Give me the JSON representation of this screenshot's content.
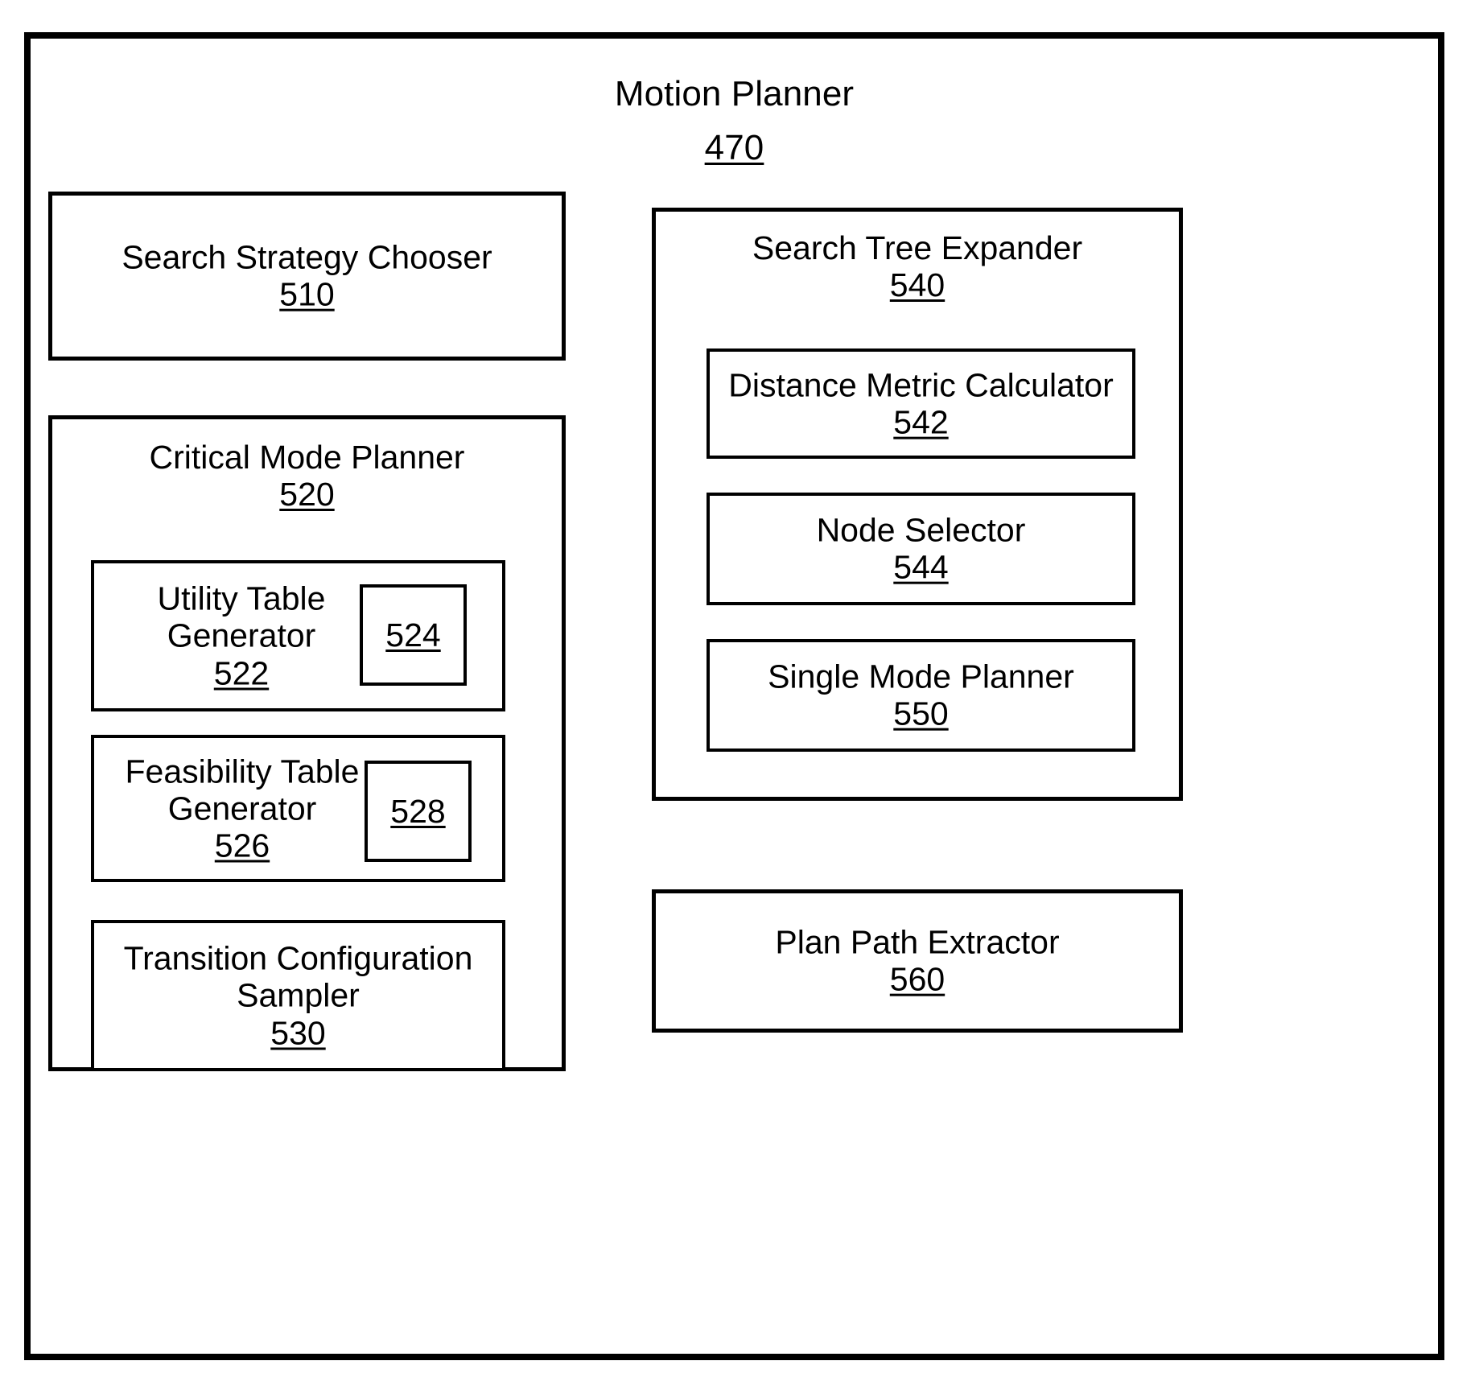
{
  "figure": {
    "root": {
      "title": "Motion Planner",
      "ref": "470"
    },
    "blocks": {
      "search_strategy_chooser": {
        "title": "Search Strategy Chooser",
        "ref": "510"
      },
      "critical_mode_planner": {
        "title": "Critical Mode Planner",
        "ref": "520"
      },
      "utility_table_generator": {
        "title": "Utility Table\nGenerator",
        "ref": "522",
        "sub_ref": "524"
      },
      "feasibility_table_generator": {
        "title": "Feasibility Table\nGenerator",
        "ref": "526",
        "sub_ref": "528"
      },
      "transition_configuration_sampler": {
        "title": "Transition Configuration\nSampler",
        "ref": "530"
      },
      "search_tree_expander": {
        "title": "Search Tree Expander",
        "ref": "540"
      },
      "distance_metric_calculator": {
        "title": "Distance Metric Calculator",
        "ref": "542"
      },
      "node_selector": {
        "title": "Node Selector",
        "ref": "544"
      },
      "single_mode_planner": {
        "title": "Single Mode Planner",
        "ref": "550"
      },
      "plan_path_extractor": {
        "title": "Plan Path Extractor",
        "ref": "560"
      }
    },
    "colors": {
      "line": "#000000",
      "background": "#ffffff"
    }
  }
}
